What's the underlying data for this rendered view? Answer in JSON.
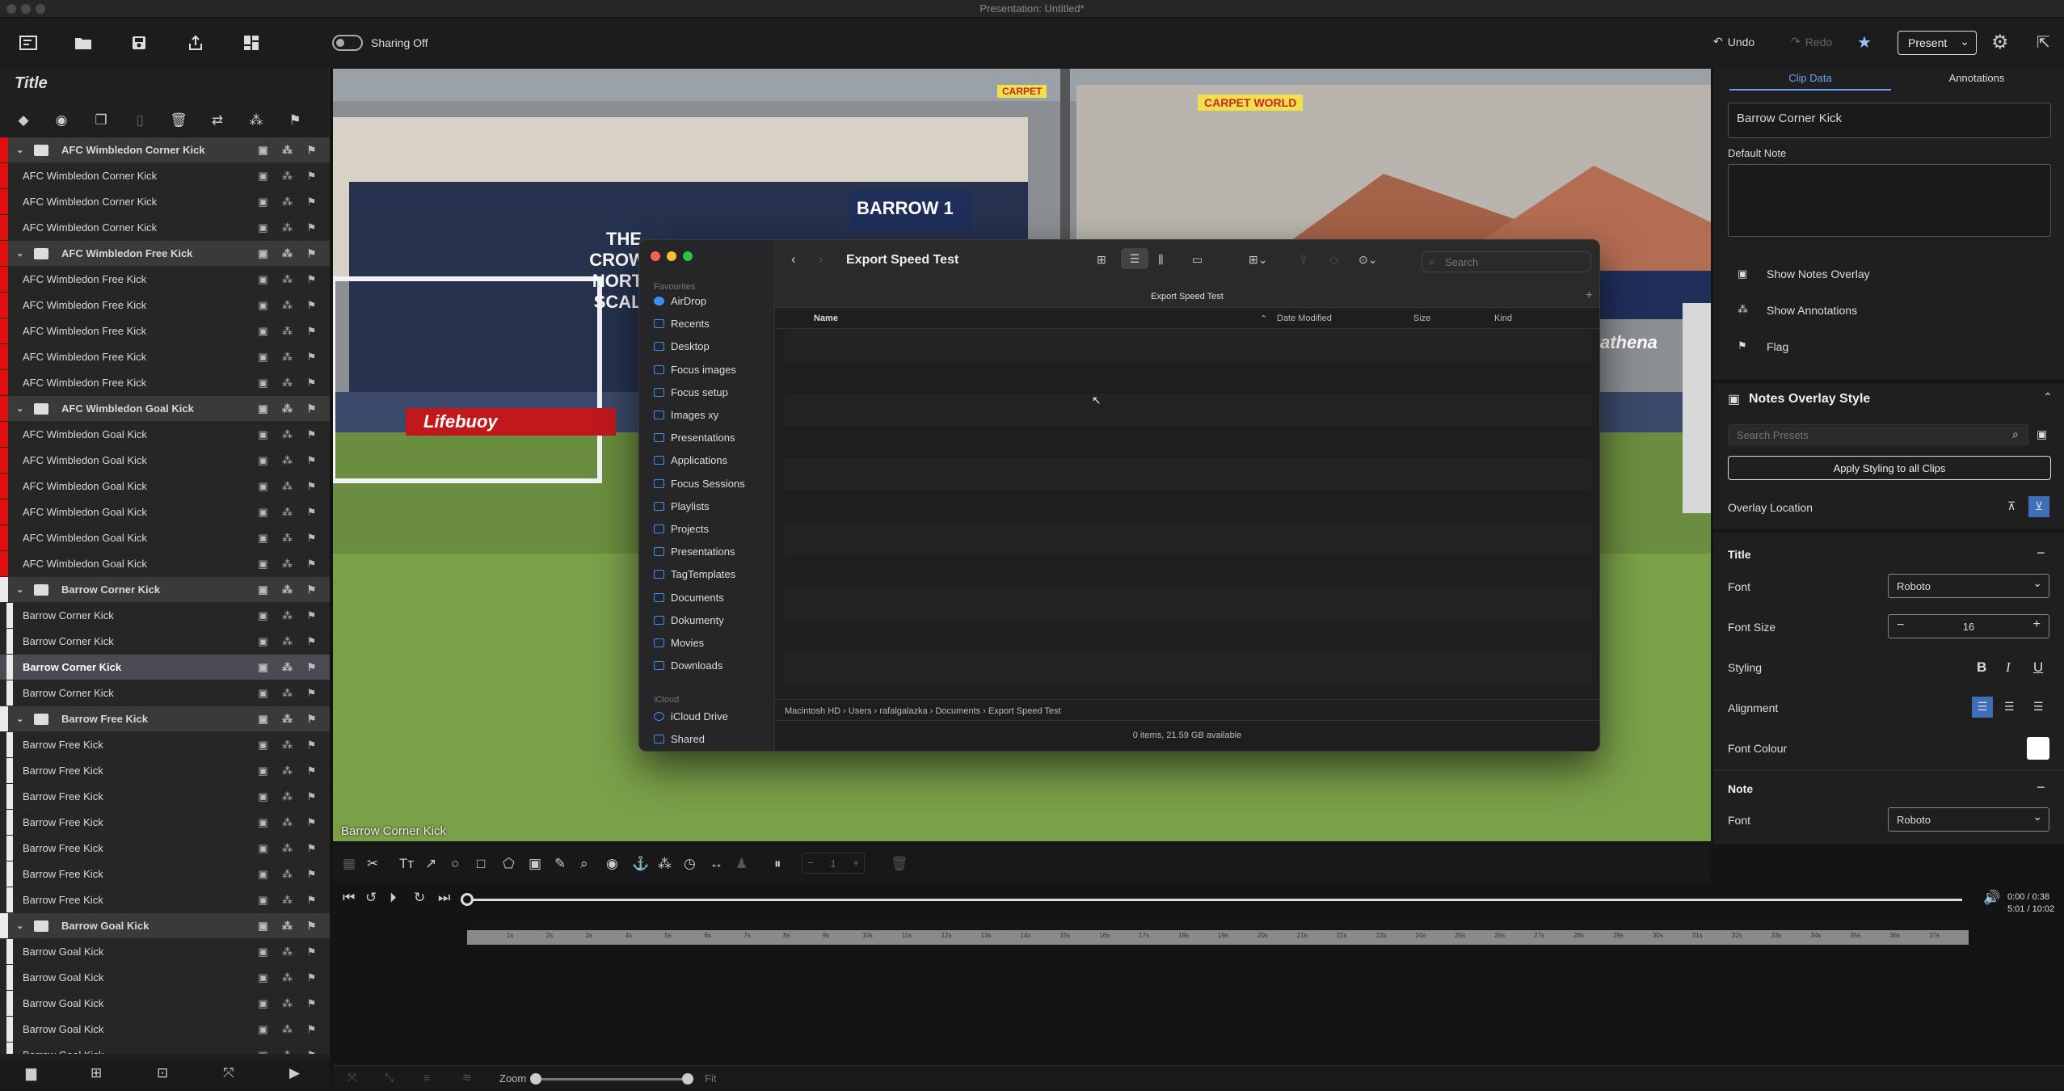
{
  "window": {
    "title": "Presentation: Untitled*"
  },
  "toolbar": {
    "sharing_label": "Sharing Off",
    "undo_label": "Undo",
    "redo_label": "Redo",
    "present_label": "Present"
  },
  "left_panel": {
    "title": "Title",
    "rows": [
      {
        "type": "group",
        "color": "red",
        "label": "AFC Wimbledon Corner Kick"
      },
      {
        "type": "clip",
        "color": "red",
        "label": "AFC Wimbledon Corner Kick"
      },
      {
        "type": "clip",
        "color": "red",
        "label": "AFC Wimbledon Corner Kick"
      },
      {
        "type": "clip",
        "color": "red",
        "label": "AFC Wimbledon Corner Kick"
      },
      {
        "type": "group",
        "color": "red",
        "label": "AFC Wimbledon Free Kick"
      },
      {
        "type": "clip",
        "color": "red",
        "label": "AFC Wimbledon Free Kick"
      },
      {
        "type": "clip",
        "color": "red",
        "label": "AFC Wimbledon Free Kick"
      },
      {
        "type": "clip",
        "color": "red",
        "label": "AFC Wimbledon Free Kick"
      },
      {
        "type": "clip",
        "color": "red",
        "label": "AFC Wimbledon Free Kick"
      },
      {
        "type": "clip",
        "color": "red",
        "label": "AFC Wimbledon Free Kick"
      },
      {
        "type": "group",
        "color": "red",
        "label": "AFC Wimbledon Goal Kick"
      },
      {
        "type": "clip",
        "color": "red",
        "label": "AFC Wimbledon Goal Kick"
      },
      {
        "type": "clip",
        "color": "red",
        "label": "AFC Wimbledon Goal Kick"
      },
      {
        "type": "clip",
        "color": "red",
        "label": "AFC Wimbledon Goal Kick"
      },
      {
        "type": "clip",
        "color": "red",
        "label": "AFC Wimbledon Goal Kick"
      },
      {
        "type": "clip",
        "color": "red",
        "label": "AFC Wimbledon Goal Kick"
      },
      {
        "type": "clip",
        "color": "red",
        "label": "AFC Wimbledon Goal Kick"
      },
      {
        "type": "group",
        "color": "white",
        "label": "Barrow Corner Kick"
      },
      {
        "type": "clip",
        "color": "white",
        "label": "Barrow Corner Kick"
      },
      {
        "type": "clip",
        "color": "white",
        "label": "Barrow Corner Kick"
      },
      {
        "type": "clip",
        "color": "white",
        "label": "Barrow Corner Kick",
        "selected": true
      },
      {
        "type": "clip",
        "color": "white",
        "label": "Barrow Corner Kick"
      },
      {
        "type": "group",
        "color": "white",
        "label": "Barrow Free Kick"
      },
      {
        "type": "clip",
        "color": "white",
        "label": "Barrow Free Kick"
      },
      {
        "type": "clip",
        "color": "white",
        "label": "Barrow Free Kick"
      },
      {
        "type": "clip",
        "color": "white",
        "label": "Barrow Free Kick"
      },
      {
        "type": "clip",
        "color": "white",
        "label": "Barrow Free Kick"
      },
      {
        "type": "clip",
        "color": "white",
        "label": "Barrow Free Kick"
      },
      {
        "type": "clip",
        "color": "white",
        "label": "Barrow Free Kick"
      },
      {
        "type": "clip",
        "color": "white",
        "label": "Barrow Free Kick"
      },
      {
        "type": "group",
        "color": "white",
        "label": "Barrow Goal Kick"
      },
      {
        "type": "clip",
        "color": "white",
        "label": "Barrow Goal Kick"
      },
      {
        "type": "clip",
        "color": "white",
        "label": "Barrow Goal Kick"
      },
      {
        "type": "clip",
        "color": "white",
        "label": "Barrow Goal Kick"
      },
      {
        "type": "clip",
        "color": "white",
        "label": "Barrow Goal Kick"
      },
      {
        "type": "clip",
        "color": "white",
        "label": "Barrow Goal Kick"
      }
    ]
  },
  "video": {
    "caption": "Barrow Corner Kick",
    "signs": [
      "THE CROWN NORTH SCALE",
      "Lifebuoy",
      "BARROW 1",
      "CARPET WORLD",
      "CARPET",
      "athena"
    ]
  },
  "finder": {
    "title": "Export Speed Test",
    "path_header": "Export Speed Test",
    "search_placeholder": "Search",
    "sidebar_sections": {
      "favourites": "Favourites",
      "icloud": "iCloud"
    },
    "sidebar_items": [
      "AirDrop",
      "Recents",
      "Desktop",
      "Focus images",
      "Focus setup",
      "Images xy",
      "Presentations",
      "Applications",
      "Focus Sessions",
      "Playlists",
      "Projects",
      "Presentations",
      "TagTemplates",
      "Documents",
      "Dokumenty",
      "Movies",
      "Downloads"
    ],
    "icloud_items": [
      "iCloud Drive",
      "Shared"
    ],
    "columns": {
      "name": "Name",
      "date": "Date Modified",
      "size": "Size",
      "kind": "Kind"
    },
    "breadcrumb": [
      "Macintosh HD",
      "Users",
      "rafalgalazka",
      "Documents",
      "Export Speed Test"
    ],
    "status": "0 items, 21.59 GB available"
  },
  "right_panel": {
    "tabs": [
      "Clip Data",
      "Annotations"
    ],
    "clip_name": "Barrow Corner Kick",
    "default_note_label": "Default Note",
    "show_notes_overlay": "Show Notes Overlay",
    "show_annotations": "Show Annotations",
    "flag": "Flag",
    "notes_overlay_style": "Notes Overlay Style",
    "search_presets_placeholder": "Search Presets",
    "apply_styling": "Apply Styling to all Clips",
    "overlay_location": "Overlay Location",
    "title_section": "Title",
    "font_label": "Font",
    "font_value": "Roboto",
    "font_size_label": "Font Size",
    "font_size_value": "16",
    "styling_label": "Styling",
    "alignment_label": "Alignment",
    "font_colour_label": "Font Colour",
    "note_section": "Note",
    "note_font_label": "Font",
    "note_font_value": "Roboto"
  },
  "annotation_bar": {
    "stepper_value": "1"
  },
  "playback": {
    "time_current": "0:00 / 0:38",
    "time_total": "5:01 / 10:02"
  },
  "timeline": {
    "ticks": [
      "1s",
      "2s",
      "3s",
      "4s",
      "5s",
      "6s",
      "7s",
      "8s",
      "9s",
      "10s",
      "11s",
      "12s",
      "13s",
      "14s",
      "15s",
      "16s",
      "17s",
      "18s",
      "19s",
      "20s",
      "21s",
      "22s",
      "23s",
      "24s",
      "25s",
      "26s",
      "27s",
      "28s",
      "29s",
      "30s",
      "31s",
      "32s",
      "33s",
      "34s",
      "35s",
      "36s",
      "37s"
    ]
  },
  "bottom_bar": {
    "zoom_label": "Zoom",
    "fit_label": "Fit"
  },
  "colors": {
    "accent": "#6f9ff5",
    "afc": "#e01010",
    "barrow": "#eaeaea"
  }
}
